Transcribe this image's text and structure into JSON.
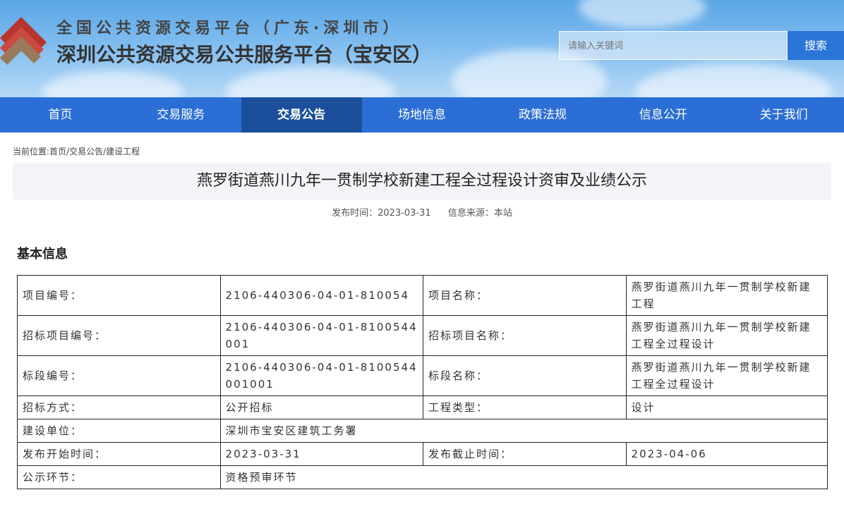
{
  "header": {
    "title_line1": "全国公共资源交易平台（广东·深圳市）",
    "title_line2": "深圳公共资源交易公共服务平台（宝安区）",
    "search_placeholder": "请输入关键词",
    "search_button": "搜索"
  },
  "nav": [
    {
      "label": "首页"
    },
    {
      "label": "交易服务"
    },
    {
      "label": "交易公告"
    },
    {
      "label": "场地信息"
    },
    {
      "label": "政策法规"
    },
    {
      "label": "信息公开"
    },
    {
      "label": "关于我们"
    }
  ],
  "breadcrumb": "当前位置:首页/交易公告/建设工程",
  "article": {
    "title": "燕罗街道燕川九年一贯制学校新建工程全过程设计资审及业绩公示",
    "publish_time": "发布时间：2023-03-31",
    "source": "信息来源：本站"
  },
  "section_title": "基本信息",
  "table": [
    {
      "l1": "项目编号：",
      "v1": "2106-440306-04-01-810054",
      "l2": "项目名称：",
      "v2": "燕罗街道燕川九年一贯制学校新建工程"
    },
    {
      "l1": "招标项目编号：",
      "v1": "2106-440306-04-01-8100544001",
      "l2": "招标项目名称：",
      "v2": "燕罗街道燕川九年一贯制学校新建工程全过程设计"
    },
    {
      "l1": "标段编号：",
      "v1": "2106-440306-04-01-8100544001001",
      "l2": "标段名称：",
      "v2": "燕罗街道燕川九年一贯制学校新建工程全过程设计"
    },
    {
      "l1": "招标方式：",
      "v1": "公开招标",
      "l2": "工程类型：",
      "v2": "设计"
    },
    {
      "l1": "建设单位：",
      "v1": "深圳市宝安区建筑工务署"
    },
    {
      "l1": "发布开始时间：",
      "v1": "2023-03-31",
      "l2": "发布截止时间：",
      "v2": "2023-04-06"
    },
    {
      "l1": "公示环节：",
      "v1": "资格预审环节"
    }
  ],
  "colors": {
    "nav_bg": "#2b6fd6",
    "nav_active": "#1b4f9c",
    "logo_red": "#b7342f",
    "logo_brown": "#9a7a5a"
  }
}
